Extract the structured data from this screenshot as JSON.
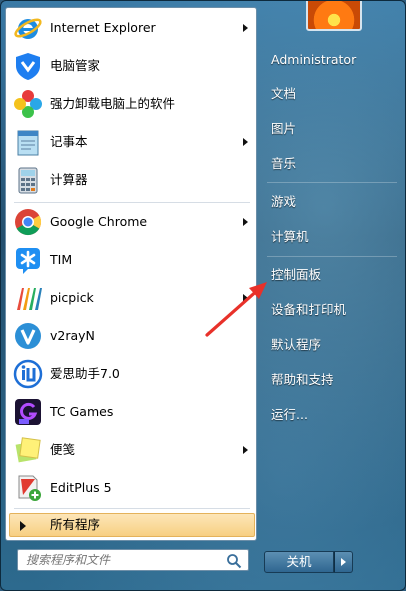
{
  "programs": [
    {
      "label": "Internet Explorer",
      "icon": "ie-icon",
      "submenu": true
    },
    {
      "label": "电脑管家",
      "icon": "pc-manager-icon",
      "submenu": false
    },
    {
      "label": "强力卸载电脑上的软件",
      "icon": "uninstaller-icon",
      "submenu": false
    },
    {
      "label": "记事本",
      "icon": "notepad-icon",
      "submenu": true
    },
    {
      "label": "计算器",
      "icon": "calculator-icon",
      "submenu": false
    },
    {
      "label": "Google Chrome",
      "icon": "chrome-icon",
      "submenu": true
    },
    {
      "label": "TIM",
      "icon": "tim-icon",
      "submenu": false
    },
    {
      "label": "picpick",
      "icon": "picpick-icon",
      "submenu": true
    },
    {
      "label": "v2rayN",
      "icon": "v2rayn-icon",
      "submenu": false
    },
    {
      "label": "爱思助手7.0",
      "icon": "i4-assistant-icon",
      "submenu": false
    },
    {
      "label": "TC Games",
      "icon": "tc-games-icon",
      "submenu": false
    },
    {
      "label": "便笺",
      "icon": "sticky-notes-icon",
      "submenu": true
    },
    {
      "label": "EditPlus 5",
      "icon": "editplus-icon",
      "submenu": false
    }
  ],
  "all_programs_label": "所有程序",
  "search": {
    "placeholder": "搜索程序和文件"
  },
  "right_panel": {
    "user": "Administrator",
    "items": [
      "文档",
      "图片",
      "音乐",
      "游戏",
      "计算机",
      "控制面板",
      "设备和打印机",
      "默认程序",
      "帮助和支持",
      "运行..."
    ]
  },
  "shutdown_label": "关机",
  "colors": {
    "accent": "#f7cf82",
    "annotation": "#e8312a",
    "frame": "#2d6a8e"
  }
}
